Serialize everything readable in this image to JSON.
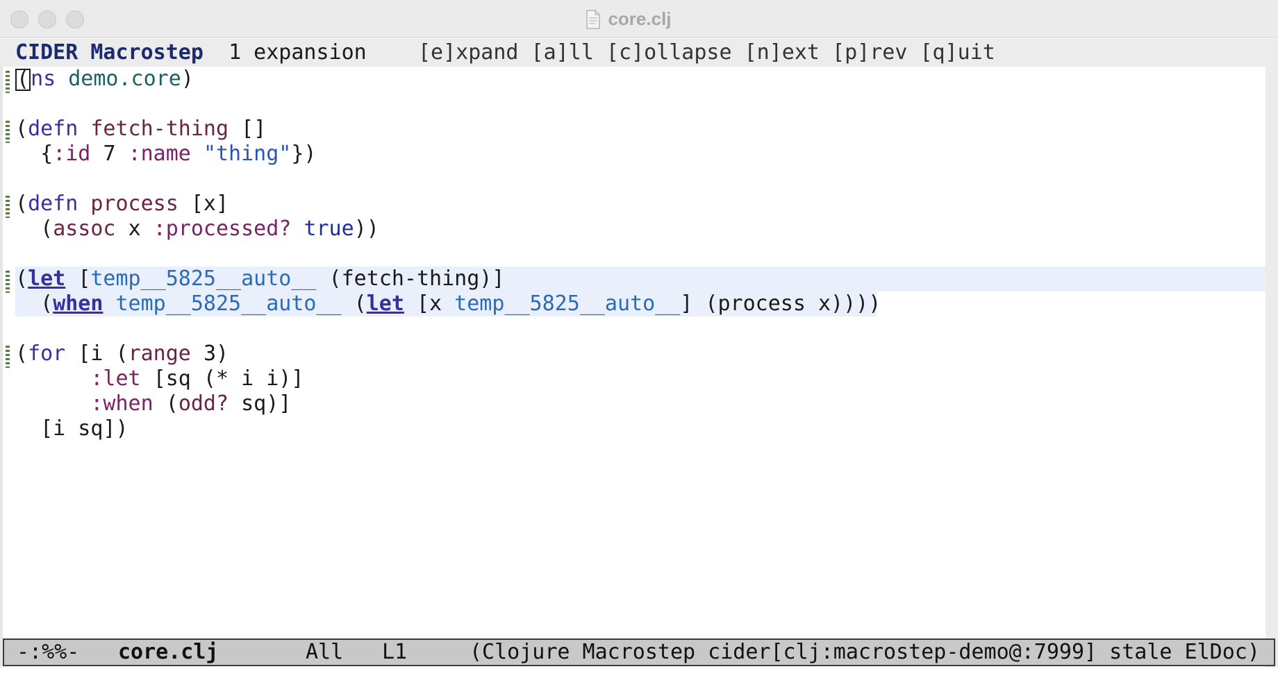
{
  "window": {
    "title": "core.clj"
  },
  "header_line": {
    "brand": "CIDER Macrostep",
    "count": "1 expansion",
    "keys": "[e]xpand [a]ll [c]ollapse [n]ext [p]rev [q]uit"
  },
  "code": {
    "ns_open": "(",
    "ns_kw": "ns",
    "ns_name": "demo.core",
    "ns_close": ")",
    "defn1_open": "(",
    "defn1_kw": "defn",
    "defn1_name": "fetch-thing",
    "defn1_args": "[]",
    "defn1_body_open": "{",
    "defn1_k1": ":id",
    "defn1_v1": "7",
    "defn1_k2": ":name",
    "defn1_v2": "\"thing\"",
    "defn1_body_close": "})",
    "defn2_open": "(",
    "defn2_kw": "defn",
    "defn2_name": "process",
    "defn2_args": "[x]",
    "defn2_b_open": "(",
    "defn2_b_fn": "assoc",
    "defn2_b_x": "x",
    "defn2_b_k": ":processed?",
    "defn2_b_v": "true",
    "defn2_b_close": "))",
    "exp_open": "(",
    "exp_let1": "let",
    "exp_bind_open": "[",
    "exp_sym": "temp__5825__auto__",
    "exp_call": "(fetch-thing)]",
    "exp2_open": "(",
    "exp_when": "when",
    "exp2_sym": "temp__5825__auto__",
    "exp2_paren": "(",
    "exp_let2": "let",
    "exp2_bind_open": "[x",
    "exp3_sym": "temp__5825__auto__",
    "exp_tail": "] (process x))))",
    "for_open": "(",
    "for_kw": "for",
    "for_bind": "[i (",
    "for_range": "range",
    "for_range_tail": "3)",
    "for_let_k": ":let",
    "for_let_v": "[sq (* i i)]",
    "for_when_k": ":when",
    "for_when_v_open": "(",
    "for_when_fn": "odd?",
    "for_when_tail": "sq)]",
    "for_body": "[i sq])"
  },
  "mode_line": {
    "status": "-:%%-",
    "file": "core.clj",
    "position": "All",
    "line": "L1",
    "modes": "(Clojure Macrostep cider[clj:macrostep-demo@:7999] stale ElDoc)"
  }
}
